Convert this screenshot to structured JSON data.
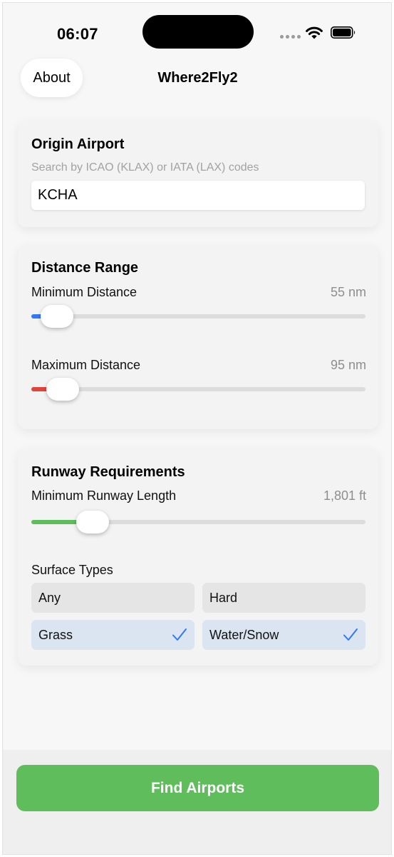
{
  "status_bar": {
    "time": "06:07"
  },
  "nav": {
    "about_label": "About",
    "title": "Where2Fly2"
  },
  "origin": {
    "title": "Origin Airport",
    "hint": "Search by ICAO (KLAX) or IATA (LAX) codes",
    "value": "KCHA"
  },
  "distance": {
    "title": "Distance Range",
    "min_label": "Minimum Distance",
    "min_value": "55 nm",
    "min_fraction": 0.03,
    "max_label": "Maximum Distance",
    "max_value": "95 nm",
    "max_fraction": 0.05
  },
  "runway": {
    "title": "Runway Requirements",
    "length_label": "Minimum Runway Length",
    "length_value": "1,801 ft",
    "length_fraction": 0.15,
    "surface_label": "Surface Types",
    "surfaces": [
      {
        "label": "Any",
        "selected": false
      },
      {
        "label": "Hard",
        "selected": false
      },
      {
        "label": "Grass",
        "selected": true
      },
      {
        "label": "Water/Snow",
        "selected": true
      }
    ]
  },
  "colors": {
    "accent_blue": "#3478f6",
    "slider_red": "#e0443a",
    "slider_green": "#5fbd5c",
    "find_button": "#5fbd5c",
    "selected_chip": "#dae5f1"
  },
  "footer": {
    "find_label": "Find Airports"
  }
}
